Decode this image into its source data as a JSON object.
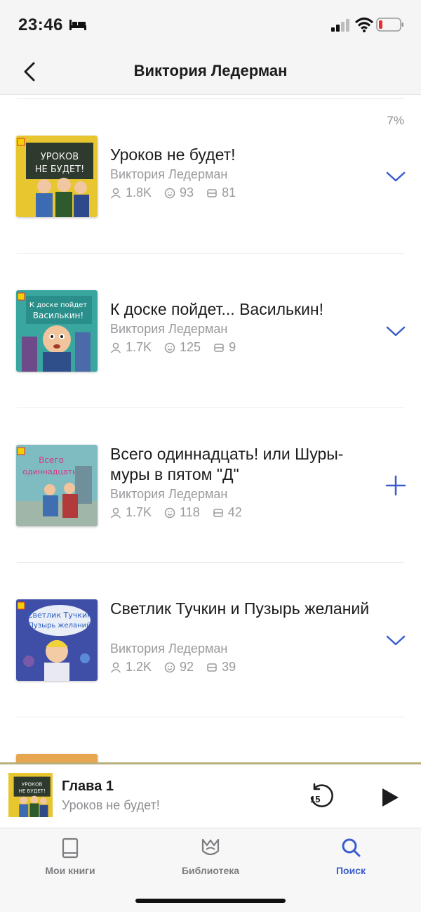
{
  "status_bar": {
    "time": "23:46"
  },
  "header": {
    "title": "Виктория Ледерман"
  },
  "progress_text": "7%",
  "books": [
    {
      "title": "Уроков не будет!",
      "author": "Виктория Ледерман",
      "listeners": "1.8K",
      "likes": "93",
      "chapters": "81",
      "action": "chevron-down-icon"
    },
    {
      "title": "К доске пойдет... Василькин!",
      "author": "Виктория Ледерман",
      "listeners": "1.7K",
      "likes": "125",
      "chapters": "9",
      "action": "chevron-down-icon"
    },
    {
      "title": "Всего одиннадцать! или Шуры-муры в пятом \"Д\"",
      "author": "Виктория Ледерман",
      "listeners": "1.7K",
      "likes": "118",
      "chapters": "42",
      "action": "plus-icon"
    },
    {
      "title": "Светлик Тучкин и Пузырь желаний",
      "author": "Виктория Ледерман",
      "listeners": "1.2K",
      "likes": "92",
      "chapters": "39",
      "action": "chevron-down-icon"
    }
  ],
  "mini_player": {
    "chapter": "Глава 1",
    "book": "Уроков не будет!",
    "rewind_seconds": "15"
  },
  "tabs": [
    {
      "label": "Мои книги",
      "icon": "book-icon",
      "active": false
    },
    {
      "label": "Библиотека",
      "icon": "library-icon",
      "active": false
    },
    {
      "label": "Поиск",
      "icon": "search-icon",
      "active": true
    }
  ],
  "colors": {
    "accent": "#3a5ccc",
    "muted": "#9a9a9e",
    "tab_inactive": "#7d7d82"
  }
}
